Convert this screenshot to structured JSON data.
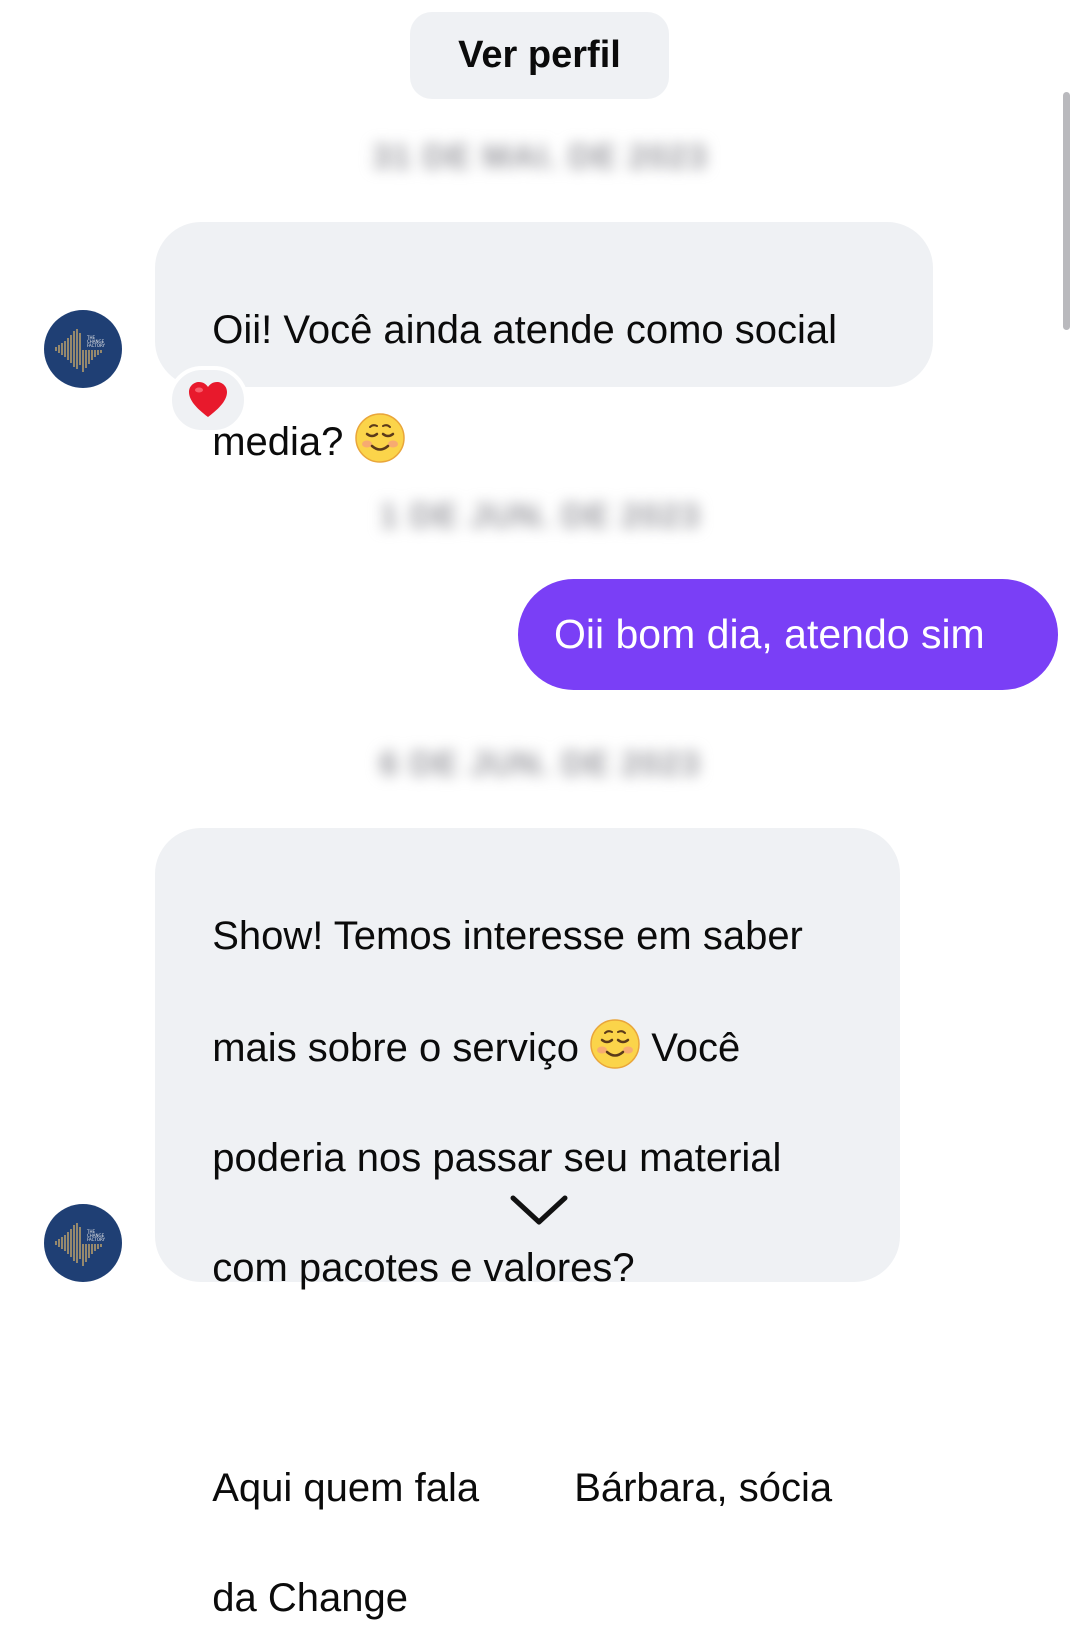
{
  "header": {
    "profile_button_label": "Ver perfil"
  },
  "date_separators": [
    "31 DE MAI. DE 2023",
    "1 DE JUN. DE 2023",
    "6 DE JUN. DE 2023"
  ],
  "messages": [
    {
      "direction": "incoming",
      "text_line1": "Oii! Você ainda atende como social",
      "text_line2": "media? ",
      "emoji": "smiling-face-icon",
      "reaction": "heart-icon"
    },
    {
      "direction": "outgoing",
      "text": "Oii bom dia, atendo sim"
    },
    {
      "direction": "incoming",
      "line1": "Show! Temos interesse em saber",
      "line2_pre": "mais sobre o serviço ",
      "emoji": "smiling-face-icon",
      "line2_post": " Você",
      "line3": "poderia nos passar seu material",
      "line4": "com pacotes e valores?",
      "line5_pre": "Aqui quem fala ",
      "line5_post": "Bárbara, sócia",
      "line6": "da Change"
    }
  ],
  "avatar": {
    "brand": "THE CHANGE FACTORY",
    "color": "#1f3f74",
    "accent": "#c8a96a"
  },
  "colors": {
    "outgoing_bubble": "#7a3ff6",
    "incoming_bubble": "#eff1f4",
    "reaction_heart": "#e8192c"
  },
  "icons": {
    "scroll_down": "chevron-down-icon"
  }
}
